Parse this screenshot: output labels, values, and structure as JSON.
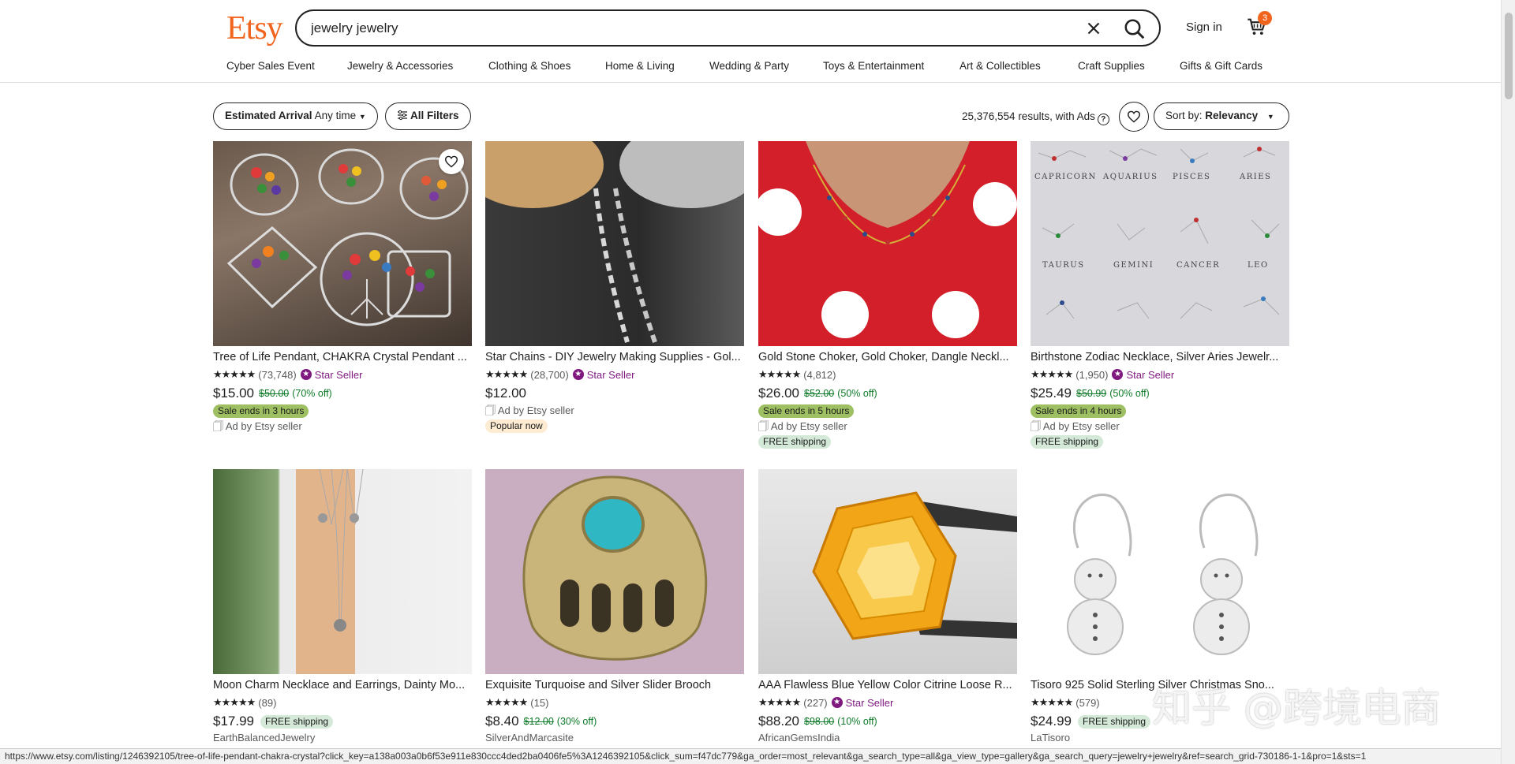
{
  "header": {
    "logo": "Etsy",
    "search_value": "jewelry jewelry",
    "signin": "Sign in",
    "cart_count": "3"
  },
  "categories": [
    "Cyber Sales Event",
    "Jewelry & Accessories",
    "Clothing & Shoes",
    "Home & Living",
    "Wedding & Party",
    "Toys & Entertainment",
    "Art & Collectibles",
    "Craft Supplies",
    "Gifts & Gift Cards"
  ],
  "filters": {
    "arrival_label": "Estimated Arrival",
    "arrival_value": "Any time",
    "all_filters": "All Filters",
    "results": "25,376,554 results, with Ads",
    "sort_label": "Sort by:",
    "sort_value": "Relevancy"
  },
  "listings": [
    {
      "title": "Tree of Life Pendant, CHAKRA Crystal Pendant ...",
      "stars": "★★★★★",
      "count": "(73,748)",
      "star_seller": "Star Seller",
      "price": "$15.00",
      "orig": "$50.00",
      "disc": "(70% off)",
      "badge": "Sale ends in 3 hours",
      "ad": "Ad by Etsy seller"
    },
    {
      "title": "Star Chains - DIY Jewelry Making Supplies - Gol...",
      "stars": "★★★★★",
      "count": "(28,700)",
      "star_seller": "Star Seller",
      "price": "$12.00",
      "ad": "Ad by Etsy seller",
      "popular": "Popular now"
    },
    {
      "title": "Gold Stone Choker, Gold Choker, Dangle Neckl...",
      "stars": "★★★★★",
      "count": "(4,812)",
      "price": "$26.00",
      "orig": "$52.00",
      "disc": "(50% off)",
      "badge": "Sale ends in 5 hours",
      "ad": "Ad by Etsy seller",
      "free": "FREE shipping"
    },
    {
      "title": "Birthstone Zodiac Necklace, Silver Aries Jewelr...",
      "stars": "★★★★★",
      "count": "(1,950)",
      "star_seller": "Star Seller",
      "price": "$25.49",
      "orig": "$50.99",
      "disc": "(50% off)",
      "badge": "Sale ends in 4 hours",
      "ad": "Ad by Etsy seller",
      "free": "FREE shipping"
    },
    {
      "title": "Moon Charm Necklace and Earrings, Dainty Mo...",
      "stars": "★★★★★",
      "count": "(89)",
      "price": "$17.99",
      "free_inline": "FREE shipping",
      "shop": "EarthBalancedJewelry"
    },
    {
      "title": "Exquisite Turquoise and Silver Slider Brooch",
      "stars": "★★★★★",
      "count": "(15)",
      "price": "$8.40",
      "orig": "$12.00",
      "disc": "(30% off)",
      "shop": "SilverAndMarcasite"
    },
    {
      "title": "AAA Flawless Blue Yellow Color Citrine Loose R...",
      "stars": "★★★★★",
      "count": "(227)",
      "star_seller": "Star Seller",
      "price": "$88.20",
      "orig": "$98.00",
      "disc": "(10% off)",
      "shop": "AfricanGemsIndia"
    },
    {
      "title": "Tisoro 925 Solid Sterling Silver Christmas Sno...",
      "stars": "★★★★★",
      "count": "(579)",
      "price": "$24.99",
      "free_inline": "FREE shipping",
      "shop": "LaTisoro"
    }
  ],
  "zodiac": {
    "row1": [
      "CAPRICORN",
      "AQUARIUS",
      "PISCES",
      "ARIES"
    ],
    "row2": [
      "TAURUS",
      "GEMINI",
      "CANCER",
      "LEO"
    ]
  },
  "status_url": "https://www.etsy.com/listing/1246392105/tree-of-life-pendant-chakra-crystal?click_key=a138a003a0b6f53e911e830ccc4ded2ba0406fe5%3A1246392105&click_sum=f47dc779&ga_order=most_relevant&ga_search_type=all&ga_view_type=gallery&ga_search_query=jewelry+jewelry&ref=search_grid-730186-1-1&pro=1&sts=1",
  "watermark": "知乎 @跨境电商",
  "colors": {
    "brand": "#F1641E",
    "star_seller": "#7F187F",
    "discount": "#0E7A28",
    "sale_badge": "#9EC063",
    "free_badge": "#D4E9D7"
  }
}
